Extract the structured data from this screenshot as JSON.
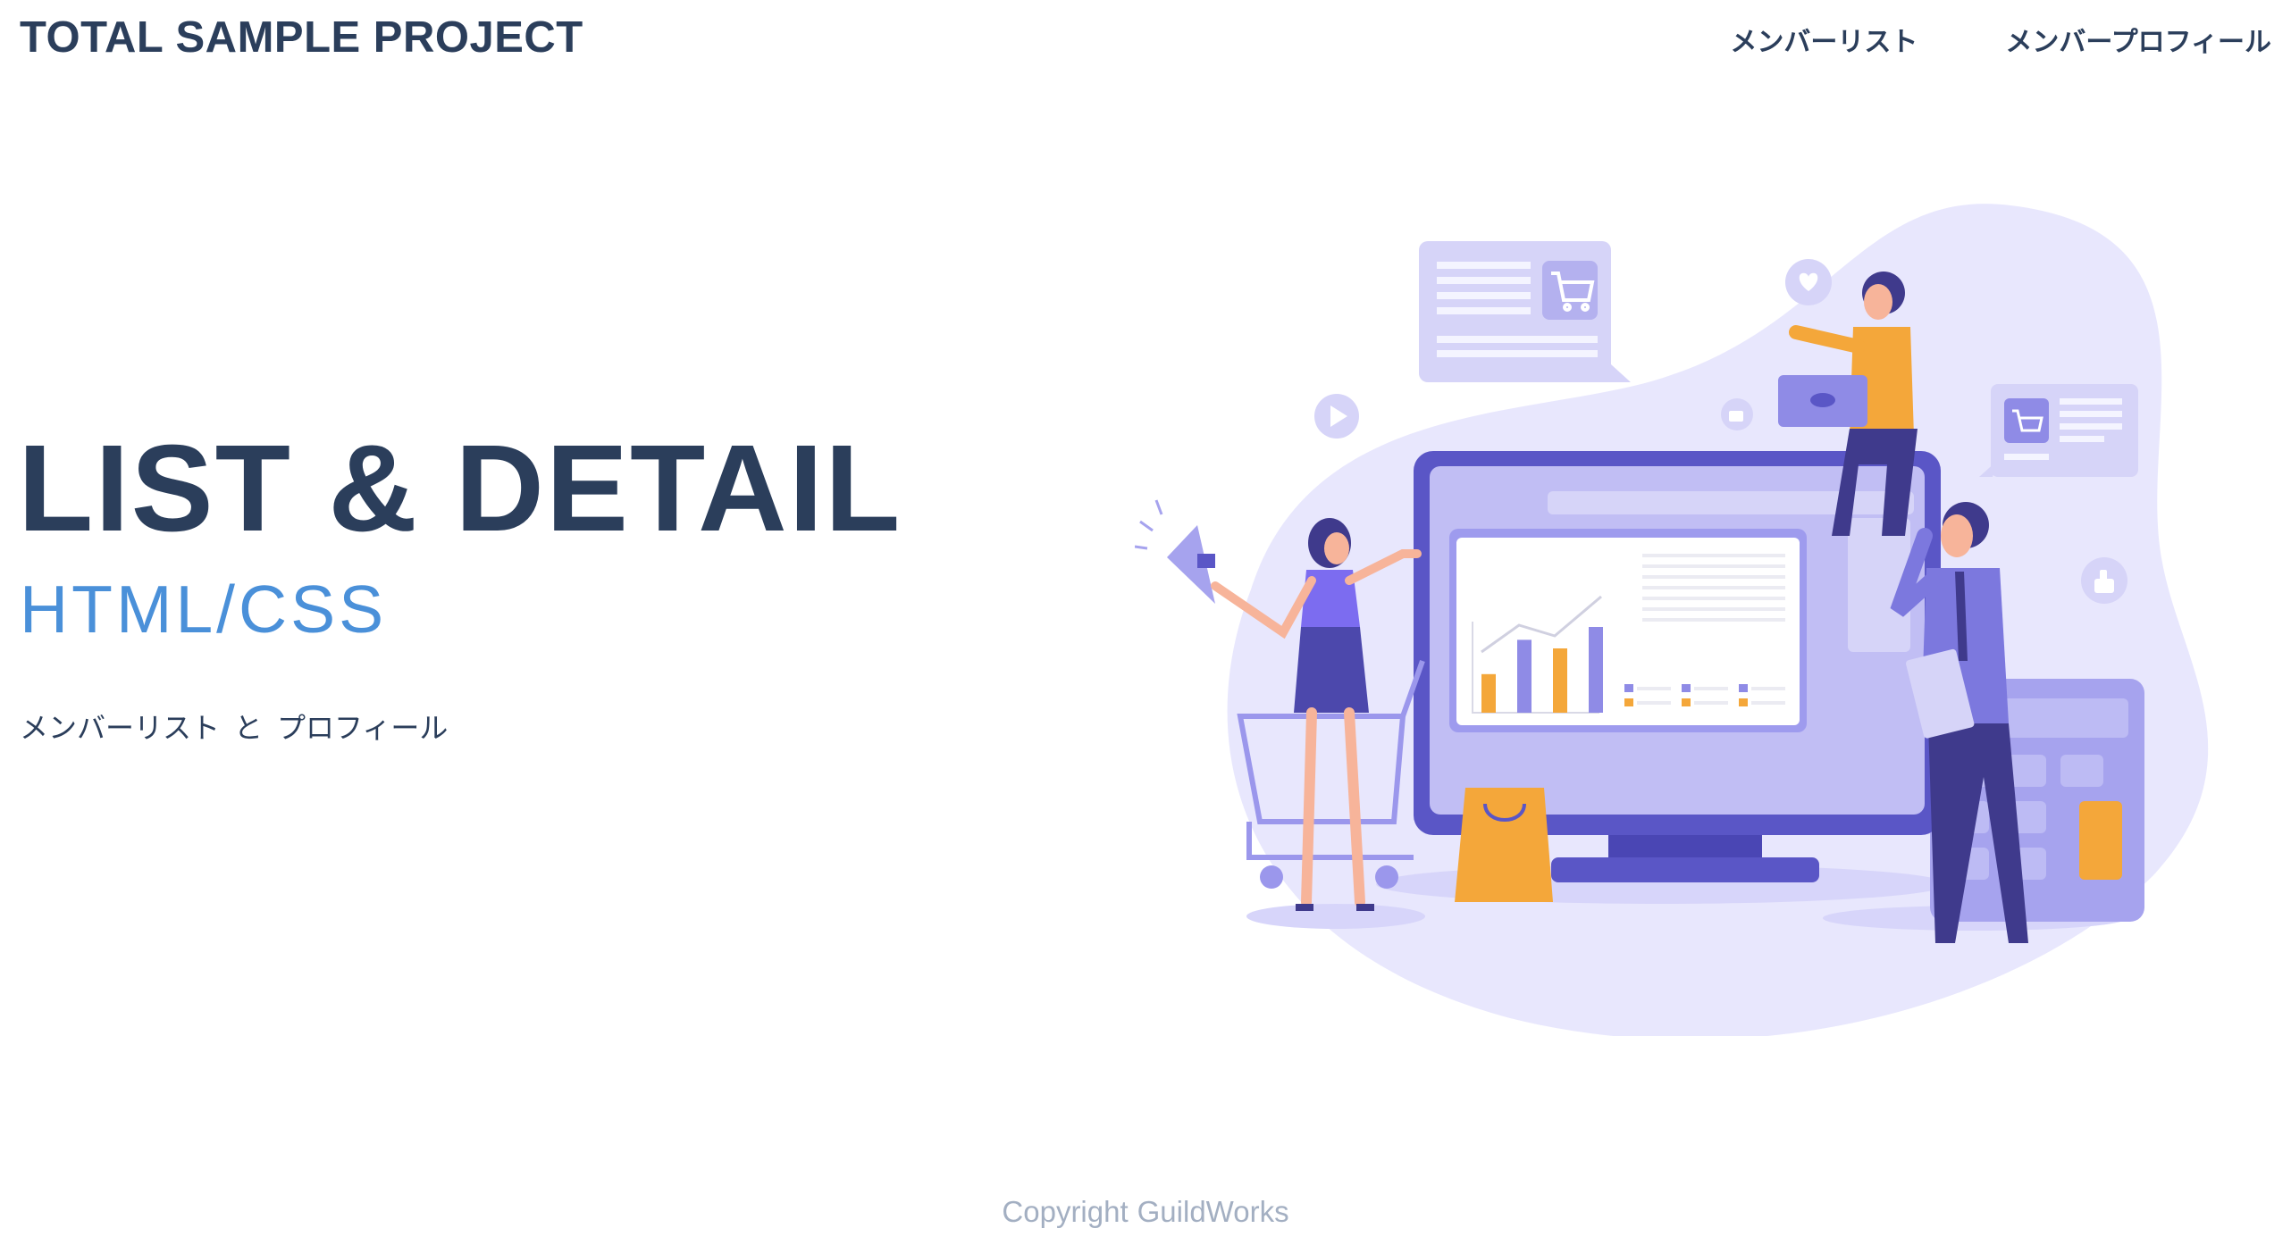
{
  "header": {
    "brand": "TOTAL SAMPLE PROJECT",
    "nav": [
      {
        "label": "メンバーリスト"
      },
      {
        "label": "メンバープロフィール"
      }
    ]
  },
  "hero": {
    "title": "LIST & DETAIL",
    "subtitle": "HTML/CSS",
    "description": {
      "part1": "メンバーリスト",
      "conjunction": "と",
      "part2": "プロフィール"
    }
  },
  "footer": {
    "copyright": "Copyright",
    "company": "GuildWorks"
  },
  "colors": {
    "text_primary": "#2b3e5b",
    "accent_blue": "#4a90d9",
    "illustration_purple": "#5a56c6",
    "illustration_lavender": "#e8e7fd",
    "illustration_orange": "#f4a73a",
    "footer_text": "#a3afc2"
  },
  "illustration": {
    "chart_bars": [
      0.45,
      0.85,
      0.75,
      1.0
    ]
  }
}
